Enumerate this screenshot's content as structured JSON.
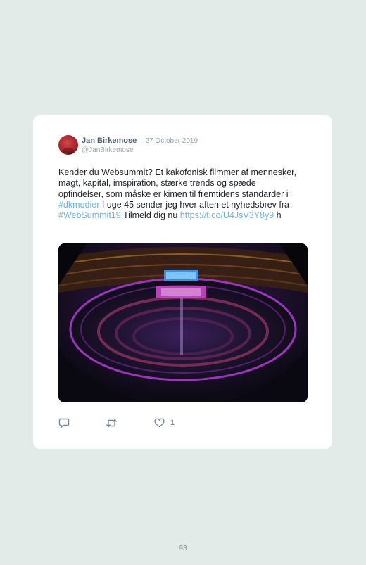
{
  "tweet": {
    "author_name": "Jan Birkemose",
    "separator": "·",
    "date": "27 October 2019",
    "handle": "@JanBirkemose",
    "text_1": "Kender du Websummit? Et kakofonisk flimmer af mennesker, magt, kapital, imspiration, stærke trends og spæde opfindelser, som måske er kimen til fremtidens standarder i ",
    "hashtag_1": "#dkmedier",
    "text_2": " I uge 45 sender jeg hver aften et nyhedsbrev fra ",
    "hashtag_2": "#WebSummit19",
    "text_3": " Tilmeld dig nu ",
    "link": "https://t.co/U4JsV3Y8y9",
    "text_4": " h",
    "like_count": "1"
  },
  "icons": {
    "avatar": "profile-photo",
    "reply": "reply-icon",
    "retweet": "retweet-icon",
    "like": "heart-icon"
  },
  "colors": {
    "background": "#e3ebe8",
    "card": "#ffffff",
    "link": "#6bb4e0",
    "icon": "#6b8599"
  },
  "page": {
    "number": "93"
  }
}
